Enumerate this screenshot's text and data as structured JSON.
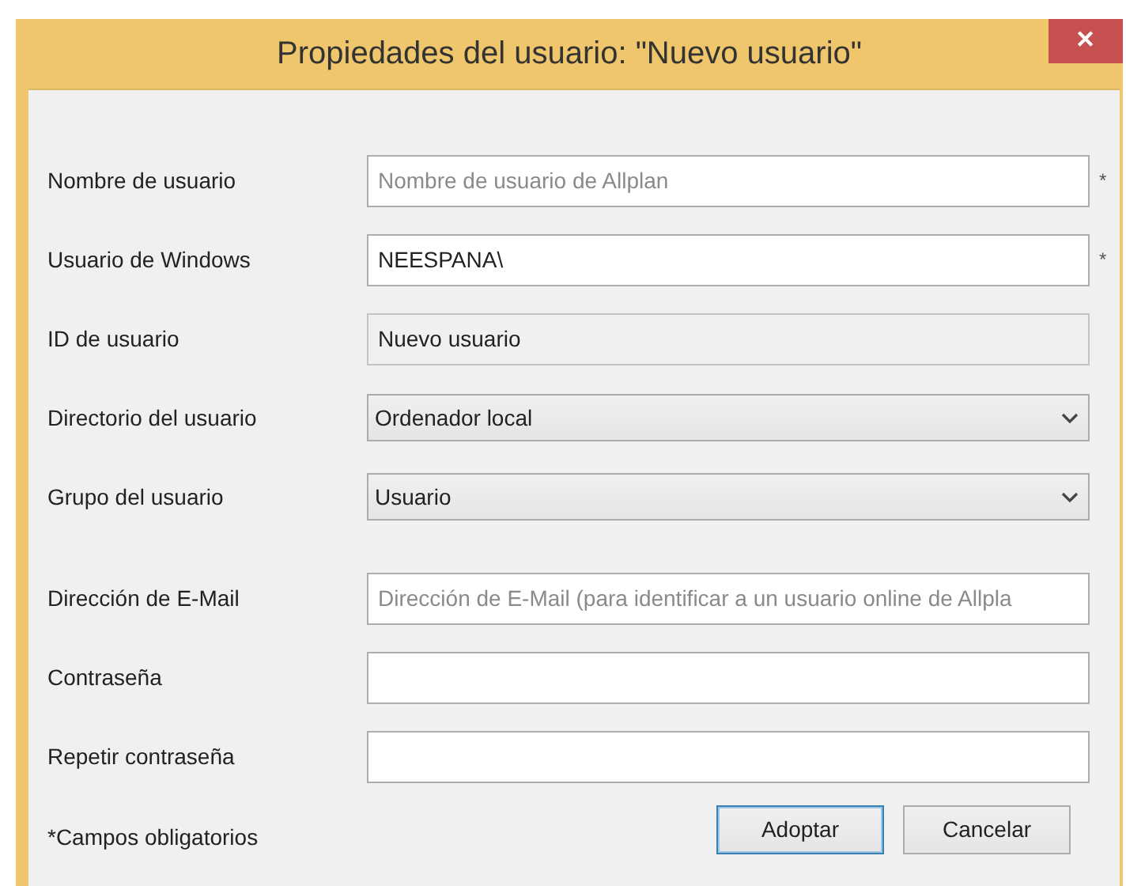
{
  "window": {
    "title": "Propiedades del usuario: \"Nuevo usuario\"",
    "close": "✕"
  },
  "account_fields": [
    {
      "label": "Nombre de usuario",
      "kind": "text",
      "placeholder": "Nombre de usuario de Allplan",
      "marker": "*"
    },
    {
      "label": "Usuario de Windows",
      "kind": "text",
      "value": "NEESPANA\\",
      "marker": "*"
    },
    {
      "label": "ID de usuario",
      "kind": "readonly",
      "value": "Nuevo usuario"
    },
    {
      "label": "Directorio del usuario",
      "kind": "select",
      "value": "Ordenador local"
    },
    {
      "label": "Grupo del usuario",
      "kind": "select",
      "value": "Usuario"
    }
  ],
  "contact_fields": [
    {
      "label": "Dirección de E-Mail",
      "placeholder": "Dirección de E-Mail (para identificar a un usuario online de Allpla"
    },
    {
      "label": "Contraseña"
    },
    {
      "label": "Repetir contraseña"
    }
  ],
  "required_note": "*Campos obligatorios",
  "buttons": [
    {
      "label": "Adoptar",
      "default": true
    },
    {
      "label": "Cancelar",
      "default": false
    }
  ]
}
